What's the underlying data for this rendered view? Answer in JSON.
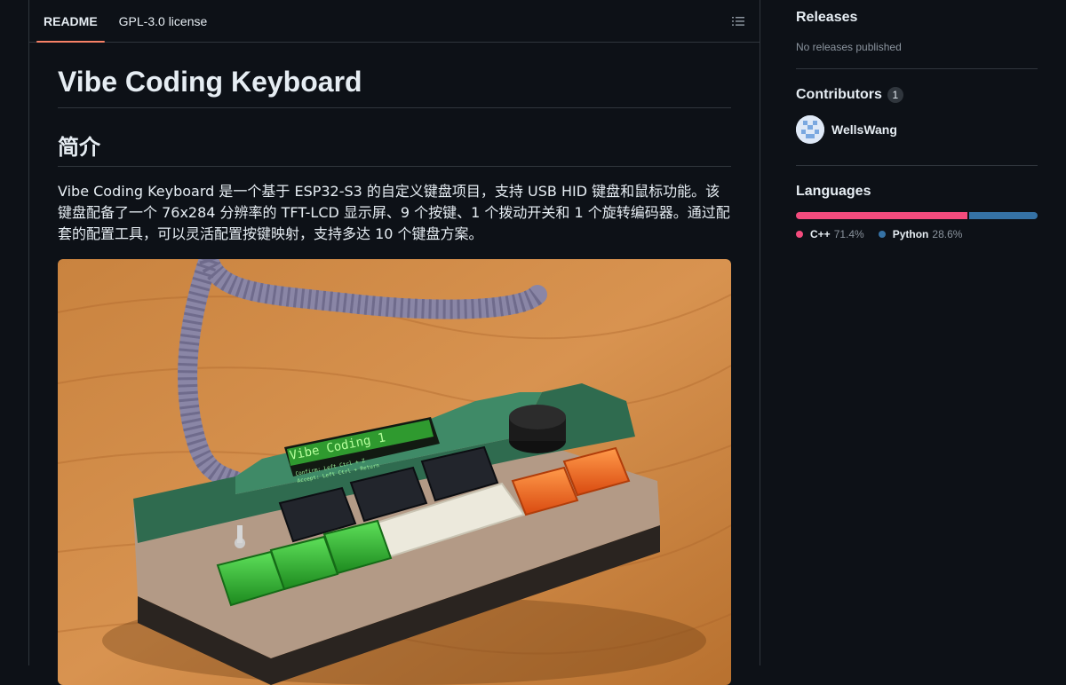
{
  "readme_tabs": [
    {
      "label": "README",
      "active": true
    },
    {
      "label": "GPL-3.0 license",
      "active": false
    }
  ],
  "outline_icon": "list-unordered-icon",
  "readme": {
    "title": "Vibe Coding Keyboard",
    "section_heading": "简介",
    "description": "Vibe Coding Keyboard 是一个基于 ESP32-S3 的自定义键盘项目，支持 USB HID 键盘和鼠标功能。该键盘配备了一个 76x284 分辨率的 TFT-LCD 显示屏、9 个按键、1 个拨动开关和 1 个旋转编码器。通过配套的配置工具，可以灵活配置按键映射，支持多达 10 个键盘方案。",
    "photo_lcd_line1": "Vibe Coding 1",
    "photo_lcd_line2": "Confirm: Left Ctrl + Z",
    "photo_lcd_line3": "Accept: Left Ctrl + Return"
  },
  "sidebar": {
    "releases": {
      "heading": "Releases",
      "empty_text": "No releases published"
    },
    "contributors": {
      "heading": "Contributors",
      "count": "1",
      "users": [
        {
          "name": "WellsWang"
        }
      ]
    },
    "languages": {
      "heading": "Languages",
      "items": [
        {
          "name": "C++",
          "percent": "71.4%",
          "share": 71.4,
          "color": "#f34b7d"
        },
        {
          "name": "Python",
          "percent": "28.6%",
          "share": 28.6,
          "color": "#3572a5"
        }
      ]
    }
  },
  "colors": {
    "accent_tab": "#f78166",
    "background": "#0d1117",
    "border": "#30363d"
  }
}
